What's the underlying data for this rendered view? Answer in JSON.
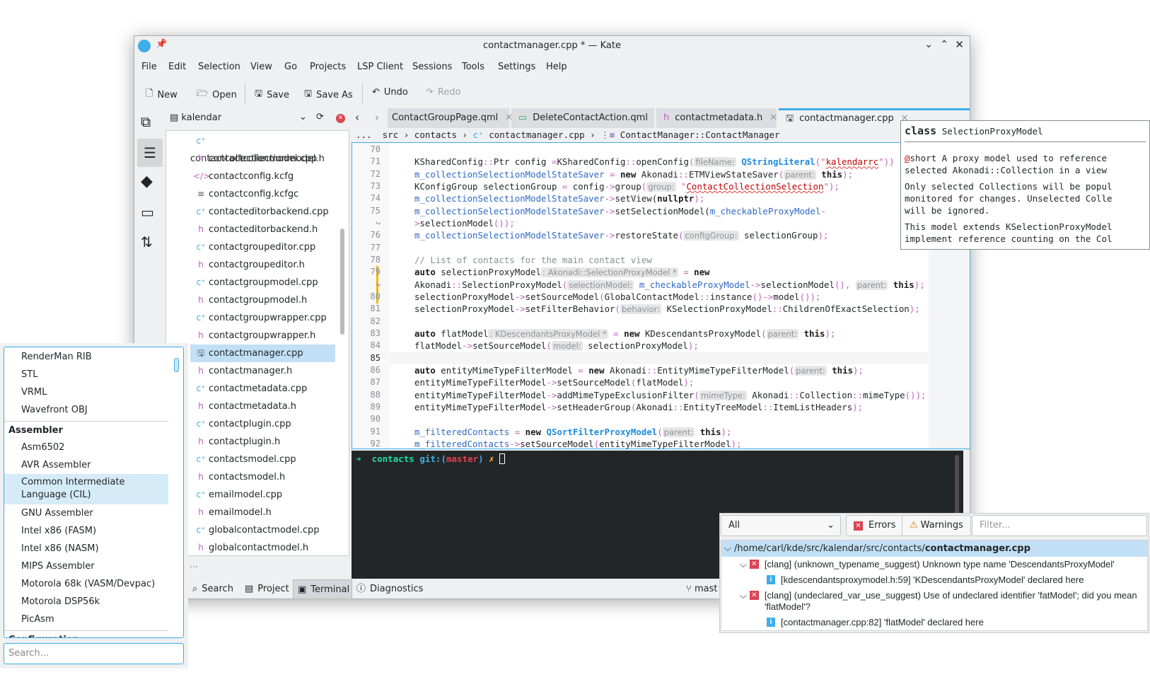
{
  "window": {
    "title": "contactmanager.cpp * — Kate"
  },
  "menu": [
    "File",
    "Edit",
    "Selection",
    "View",
    "Go",
    "Projects",
    "LSP Client",
    "Sessions",
    "Tools",
    "Settings",
    "Help"
  ],
  "toolbar": {
    "new": "New",
    "open": "Open",
    "save": "Save",
    "save_as": "Save As",
    "undo": "Undo",
    "redo": "Redo"
  },
  "project": {
    "name": "kalendar"
  },
  "tabs": [
    {
      "label": "ContactGroupPage.qml",
      "icon": "qml"
    },
    {
      "label": "DeleteContactAction.qml",
      "icon": "qml-green"
    },
    {
      "label": "contactmetadata.h",
      "icon": "h"
    },
    {
      "label": "contactmanager.cpp",
      "icon": "save",
      "active": true
    }
  ],
  "breadcrumb": {
    "ellipsis": "...",
    "src": "src",
    "contacts": "contacts",
    "file": "contactmanager.cpp",
    "symbol": "ContactManager::ContactManager"
  },
  "files": [
    {
      "name": "contactcollectionmodel.cpp",
      "type": "cpp"
    },
    {
      "name": "contactcollectionmodel.h",
      "type": "h"
    },
    {
      "name": "contactconfig.kcfg",
      "type": "xml"
    },
    {
      "name": "contactconfig.kcfgc",
      "type": "text"
    },
    {
      "name": "contacteditorbackend.cpp",
      "type": "cpp"
    },
    {
      "name": "contacteditorbackend.h",
      "type": "h"
    },
    {
      "name": "contactgroupeditor.cpp",
      "type": "cpp"
    },
    {
      "name": "contactgroupeditor.h",
      "type": "h"
    },
    {
      "name": "contactgroupmodel.cpp",
      "type": "cpp"
    },
    {
      "name": "contactgroupmodel.h",
      "type": "h"
    },
    {
      "name": "contactgroupwrapper.cpp",
      "type": "cpp"
    },
    {
      "name": "contactgroupwrapper.h",
      "type": "h"
    },
    {
      "name": "contactmanager.cpp",
      "type": "save",
      "selected": true
    },
    {
      "name": "contactmanager.h",
      "type": "h"
    },
    {
      "name": "contactmetadata.cpp",
      "type": "cpp"
    },
    {
      "name": "contactmetadata.h",
      "type": "h"
    },
    {
      "name": "contactplugin.cpp",
      "type": "cpp"
    },
    {
      "name": "contactplugin.h",
      "type": "h"
    },
    {
      "name": "contactsmodel.cpp",
      "type": "cpp"
    },
    {
      "name": "contactsmodel.h",
      "type": "h"
    },
    {
      "name": "emailmodel.cpp",
      "type": "cpp"
    },
    {
      "name": "emailmodel.h",
      "type": "h"
    },
    {
      "name": "globalcontactmodel.cpp",
      "type": "cpp"
    },
    {
      "name": "globalcontactmodel.h",
      "type": "h"
    }
  ],
  "filter_placeholder": "...",
  "code": [
    {
      "n": "70",
      "t": []
    },
    {
      "n": "71",
      "t": [
        [
          "",
          "KSharedConfig"
        ],
        [
          "p",
          "::"
        ],
        [
          "",
          "Ptr config "
        ],
        [
          "p",
          "="
        ],
        [
          "",
          "KSharedConfig"
        ],
        [
          "p",
          "::"
        ],
        [
          "",
          "openConfig"
        ],
        [
          "p",
          "("
        ],
        [
          "h",
          "fileName:"
        ],
        [
          "q",
          " QStringLiteral"
        ],
        [
          "p",
          "(\""
        ],
        [
          "s",
          "kalendarrc"
        ],
        [
          "p",
          "\"))"
        ]
      ]
    },
    {
      "n": "72",
      "t": [
        [
          "m",
          "m_collectionSelectionModelStateSaver"
        ],
        [
          "p",
          " = "
        ],
        [
          "k",
          "new"
        ],
        [
          "",
          " Akonadi"
        ],
        [
          "p",
          "::"
        ],
        [
          "",
          "ETMViewStateSaver"
        ],
        [
          "p",
          "("
        ],
        [
          "h",
          "parent:"
        ],
        [
          "k",
          " this"
        ],
        [
          "p",
          ");"
        ]
      ]
    },
    {
      "n": "73",
      "t": [
        [
          "",
          "KConfigGroup selectionGroup "
        ],
        [
          "p",
          "="
        ],
        [
          "",
          " config"
        ],
        [
          "p",
          "->"
        ],
        [
          "",
          "group"
        ],
        [
          "p",
          "("
        ],
        [
          "h",
          "group:"
        ],
        [
          "p",
          " \""
        ],
        [
          "s",
          "ContactCollectionSelection"
        ],
        [
          "p",
          "\");"
        ]
      ]
    },
    {
      "n": "74",
      "t": [
        [
          "m",
          "m_collectionSelectionModelStateSaver"
        ],
        [
          "p",
          "->"
        ],
        [
          "",
          "setView("
        ],
        [
          "k",
          "nullptr"
        ],
        [
          "p",
          ");"
        ]
      ]
    },
    {
      "n": "75",
      "t": [
        [
          "m",
          "m_collectionSelectionModelStateSaver"
        ],
        [
          "p",
          "->"
        ],
        [
          "",
          "setSelectionModel("
        ],
        [
          "m",
          "m_checkableProxyModel"
        ],
        [
          "p",
          "-"
        ]
      ]
    },
    {
      "n": "↪",
      "t": [
        [
          "p",
          ">"
        ],
        [
          "",
          "selectionModel"
        ],
        [
          "p",
          "());"
        ]
      ]
    },
    {
      "n": "76",
      "t": [
        [
          "m",
          "m_collectionSelectionModelStateSaver"
        ],
        [
          "p",
          "->"
        ],
        [
          "",
          "restoreState"
        ],
        [
          "p",
          "("
        ],
        [
          "h",
          "configGroup:"
        ],
        [
          "",
          " selectionGroup"
        ],
        [
          "p",
          ");"
        ]
      ]
    },
    {
      "n": "77",
      "t": []
    },
    {
      "n": "78",
      "t": [
        [
          "c",
          "// List of contacts for the main contact view"
        ]
      ]
    },
    {
      "n": "79",
      "t": [
        [
          "k",
          "auto"
        ],
        [
          "",
          " selectionProxyModel"
        ],
        [
          "h",
          ": Akonadi::SelectionProxyModel *"
        ],
        [
          "p",
          " = "
        ],
        [
          "k",
          "new"
        ]
      ],
      "mod": true
    },
    {
      "n": "↪",
      "t": [
        [
          "",
          "Akonadi"
        ],
        [
          "p",
          "::"
        ],
        [
          "",
          "SelectionProxyModel"
        ],
        [
          "p",
          "("
        ],
        [
          "h",
          "selectionModel:"
        ],
        [
          "m",
          " m_checkableProxyModel"
        ],
        [
          "p",
          "->"
        ],
        [
          "",
          "selectionModel"
        ],
        [
          "p",
          "(), "
        ],
        [
          "h",
          "parent:"
        ],
        [
          "k",
          " this"
        ],
        [
          "p",
          ");"
        ]
      ],
      "mod": true
    },
    {
      "n": "80",
      "t": [
        [
          "",
          "selectionProxyModel"
        ],
        [
          "p",
          "->"
        ],
        [
          "",
          "setSourceModel"
        ],
        [
          "p",
          "("
        ],
        [
          "",
          "GlobalContactModel"
        ],
        [
          "p",
          "::"
        ],
        [
          "",
          "instance"
        ],
        [
          "p",
          "()->"
        ],
        [
          "",
          "model"
        ],
        [
          "p",
          "());"
        ]
      ],
      "mod": true
    },
    {
      "n": "81",
      "t": [
        [
          "",
          "selectionProxyModel"
        ],
        [
          "p",
          "->"
        ],
        [
          "",
          "setFilterBehavior"
        ],
        [
          "p",
          "("
        ],
        [
          "h",
          "behavior:"
        ],
        [
          "",
          " KSelectionProxyModel"
        ],
        [
          "p",
          "::"
        ],
        [
          "",
          "ChildrenOfExactSelection"
        ],
        [
          "p",
          ");"
        ]
      ]
    },
    {
      "n": "82",
      "t": []
    },
    {
      "n": "83",
      "t": [
        [
          "k",
          "auto"
        ],
        [
          "",
          " flatModel"
        ],
        [
          "h",
          ": KDescendantsProxyModel *"
        ],
        [
          "p",
          " = "
        ],
        [
          "k",
          "new"
        ],
        [
          "",
          " KDescendantsProxyModel"
        ],
        [
          "p",
          "("
        ],
        [
          "h",
          "parent:"
        ],
        [
          "k",
          " this"
        ],
        [
          "p",
          ");"
        ]
      ]
    },
    {
      "n": "84",
      "t": [
        [
          "",
          "flatModel"
        ],
        [
          "p",
          "->"
        ],
        [
          "",
          "setSourceModel"
        ],
        [
          "p",
          "("
        ],
        [
          "h",
          "model:"
        ],
        [
          "",
          " selectionProxyModel"
        ],
        [
          "p",
          ");"
        ]
      ]
    },
    {
      "n": "85",
      "t": [],
      "current": true
    },
    {
      "n": "86",
      "t": [
        [
          "k",
          "auto"
        ],
        [
          "",
          " entityMimeTypeFilterModel "
        ],
        [
          "p",
          "="
        ],
        [
          "k",
          " new"
        ],
        [
          "",
          " Akonadi"
        ],
        [
          "p",
          "::"
        ],
        [
          "",
          "EntityMimeTypeFilterModel"
        ],
        [
          "p",
          "("
        ],
        [
          "h",
          "parent:"
        ],
        [
          "k",
          " this"
        ],
        [
          "p",
          ");"
        ]
      ]
    },
    {
      "n": "87",
      "t": [
        [
          "",
          "entityMimeTypeFilterModel"
        ],
        [
          "p",
          "->"
        ],
        [
          "",
          "setSourceModel"
        ],
        [
          "p",
          "("
        ],
        [
          "",
          "flatModel"
        ],
        [
          "p",
          ");"
        ]
      ]
    },
    {
      "n": "88",
      "t": [
        [
          "",
          "entityMimeTypeFilterModel"
        ],
        [
          "p",
          "->"
        ],
        [
          "",
          "addMimeTypeExclusionFilter"
        ],
        [
          "p",
          "("
        ],
        [
          "h",
          "mimeType:"
        ],
        [
          "",
          " Akonadi"
        ],
        [
          "p",
          "::"
        ],
        [
          "",
          "Collection"
        ],
        [
          "p",
          "::"
        ],
        [
          "",
          "mimeType"
        ],
        [
          "p",
          "());"
        ]
      ]
    },
    {
      "n": "89",
      "t": [
        [
          "",
          "entityMimeTypeFilterModel"
        ],
        [
          "p",
          "->"
        ],
        [
          "",
          "setHeaderGroup"
        ],
        [
          "p",
          "("
        ],
        [
          "",
          "Akonadi"
        ],
        [
          "p",
          "::"
        ],
        [
          "",
          "EntityTreeModel"
        ],
        [
          "p",
          "::"
        ],
        [
          "",
          "ItemListHeaders"
        ],
        [
          "p",
          ");"
        ]
      ]
    },
    {
      "n": "90",
      "t": []
    },
    {
      "n": "91",
      "t": [
        [
          "m",
          "m_filteredContacts"
        ],
        [
          "p",
          " = "
        ],
        [
          "k",
          "new"
        ],
        [
          "q",
          " QSortFilterProxyModel"
        ],
        [
          "p",
          "("
        ],
        [
          "h",
          "parent:"
        ],
        [
          "k",
          " this"
        ],
        [
          "p",
          ");"
        ]
      ]
    },
    {
      "n": "92",
      "t": [
        [
          "m",
          "m_filteredContacts"
        ],
        [
          "p",
          "->"
        ],
        [
          "",
          "setSourceModel"
        ],
        [
          "p",
          "("
        ],
        [
          "",
          "entityMimeTypeFilterModel"
        ],
        [
          "p",
          ");"
        ]
      ]
    }
  ],
  "tooltip": {
    "keyword": "class",
    "name": "SelectionProxyModel",
    "p1a": "@",
    "p1b": "short A proxy model used to reference",
    "p1c": "selected Akonadi::Collection in a view",
    "p2": [
      "Only selected Collections will be popul",
      "monitored for changes. Unselected Colle",
      "will be ignored."
    ],
    "p3": [
      "This model extends KSelectionProxyModel",
      "implement reference counting on the Col"
    ]
  },
  "terminal": {
    "arrow": "➜",
    "dir": "contacts",
    "git": "git:(",
    "branch": "master",
    "close": ")",
    "dirty": "✗"
  },
  "bottom_tabs": [
    "Search",
    "Project",
    "Terminal",
    "Diagnostics"
  ],
  "branch": "mast",
  "language_list": {
    "items": [
      {
        "label": "RenderMan RIB"
      },
      {
        "label": "STL"
      },
      {
        "label": "VRML"
      },
      {
        "label": "Wavefront OBJ"
      },
      {
        "label": "Assembler",
        "header": true
      },
      {
        "label": "Asm6502"
      },
      {
        "label": "AVR Assembler"
      },
      {
        "label": "Common Intermediate Language (CIL)",
        "selected": true
      },
      {
        "label": "GNU Assembler"
      },
      {
        "label": "Intel x86 (FASM)"
      },
      {
        "label": "Intel x86 (NASM)"
      },
      {
        "label": "MIPS Assembler"
      },
      {
        "label": "Motorola 68k (VASM/Devpac)"
      },
      {
        "label": "Motorola DSP56k"
      },
      {
        "label": "PicAsm"
      },
      {
        "label": "Configuration",
        "header": true
      }
    ],
    "search_placeholder": "Search..."
  },
  "diagnostics": {
    "scope": "All",
    "errors": "Errors",
    "warnings": "Warnings",
    "filter_placeholder": "Filter...",
    "file_dir": "/home/carl/kde/src/kalendar/src/contacts/",
    "file_name": "contactmanager.cpp",
    "items": [
      {
        "kind": "error",
        "text": "[clang] (unknown_typename_suggest) Unknown type name 'DescendantsProxyModel'"
      },
      {
        "kind": "info",
        "text": "[kdescendantsproxymodel.h:59] 'KDescendantsProxyModel' declared here"
      },
      {
        "kind": "error",
        "text": "[clang] (undeclared_var_use_suggest) Use of undeclared identifier 'fatModel'; did you mean 'flatModel'?"
      },
      {
        "kind": "info",
        "text": "[contactmanager.cpp:82] 'flatModel' declared here"
      }
    ]
  },
  "colors": {
    "accent": "#3daee9",
    "selection": "#c2e0f5",
    "terminal_bg": "#232627",
    "error": "#da4453",
    "warning": "#f67400"
  }
}
